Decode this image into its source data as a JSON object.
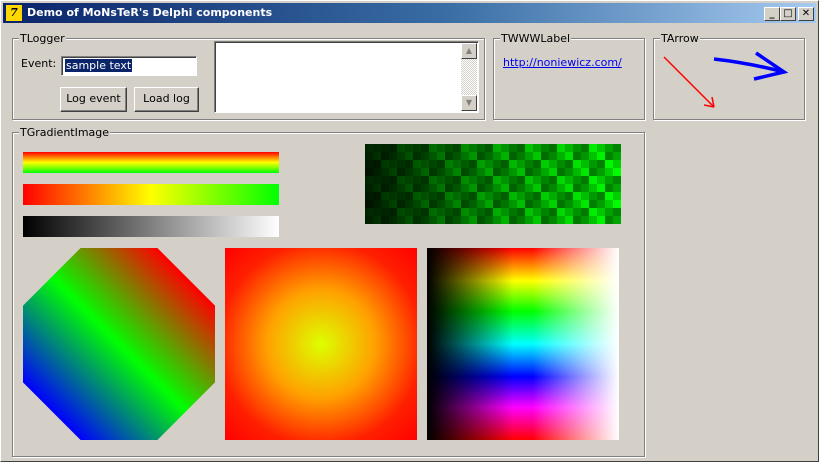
{
  "window": {
    "title": "Demo of MoNsTeR's Delphi components",
    "icon": "delphi-app-icon",
    "controls": {
      "minimize": "_",
      "maximize": "□",
      "close": "✕"
    }
  },
  "logger": {
    "caption": "TLogger",
    "event_label": "Event:",
    "event_value": "sample text",
    "log_event_button": "Log event",
    "load_log_button": "Load log",
    "memo_text": ""
  },
  "wwwlabel": {
    "caption": "TWWWLabel",
    "url": "http://noniewicz.com/"
  },
  "arrow": {
    "caption": "TArrow",
    "colors": {
      "red": "#ff0000",
      "blue": "#0000ff"
    }
  },
  "gradient": {
    "caption": "TGradientImage",
    "colors": {
      "bar1": [
        "#ff0000",
        "#ffff00",
        "#00ff00"
      ],
      "bar2": [
        "#ff0000",
        "#ffff00",
        "#00ff00"
      ],
      "bar3": [
        "#000000",
        "#ffffff"
      ],
      "octagon": [
        "#0000ff",
        "#00ff00",
        "#ff0000"
      ],
      "radial": [
        "#ddff00",
        "#ff0000"
      ]
    }
  }
}
